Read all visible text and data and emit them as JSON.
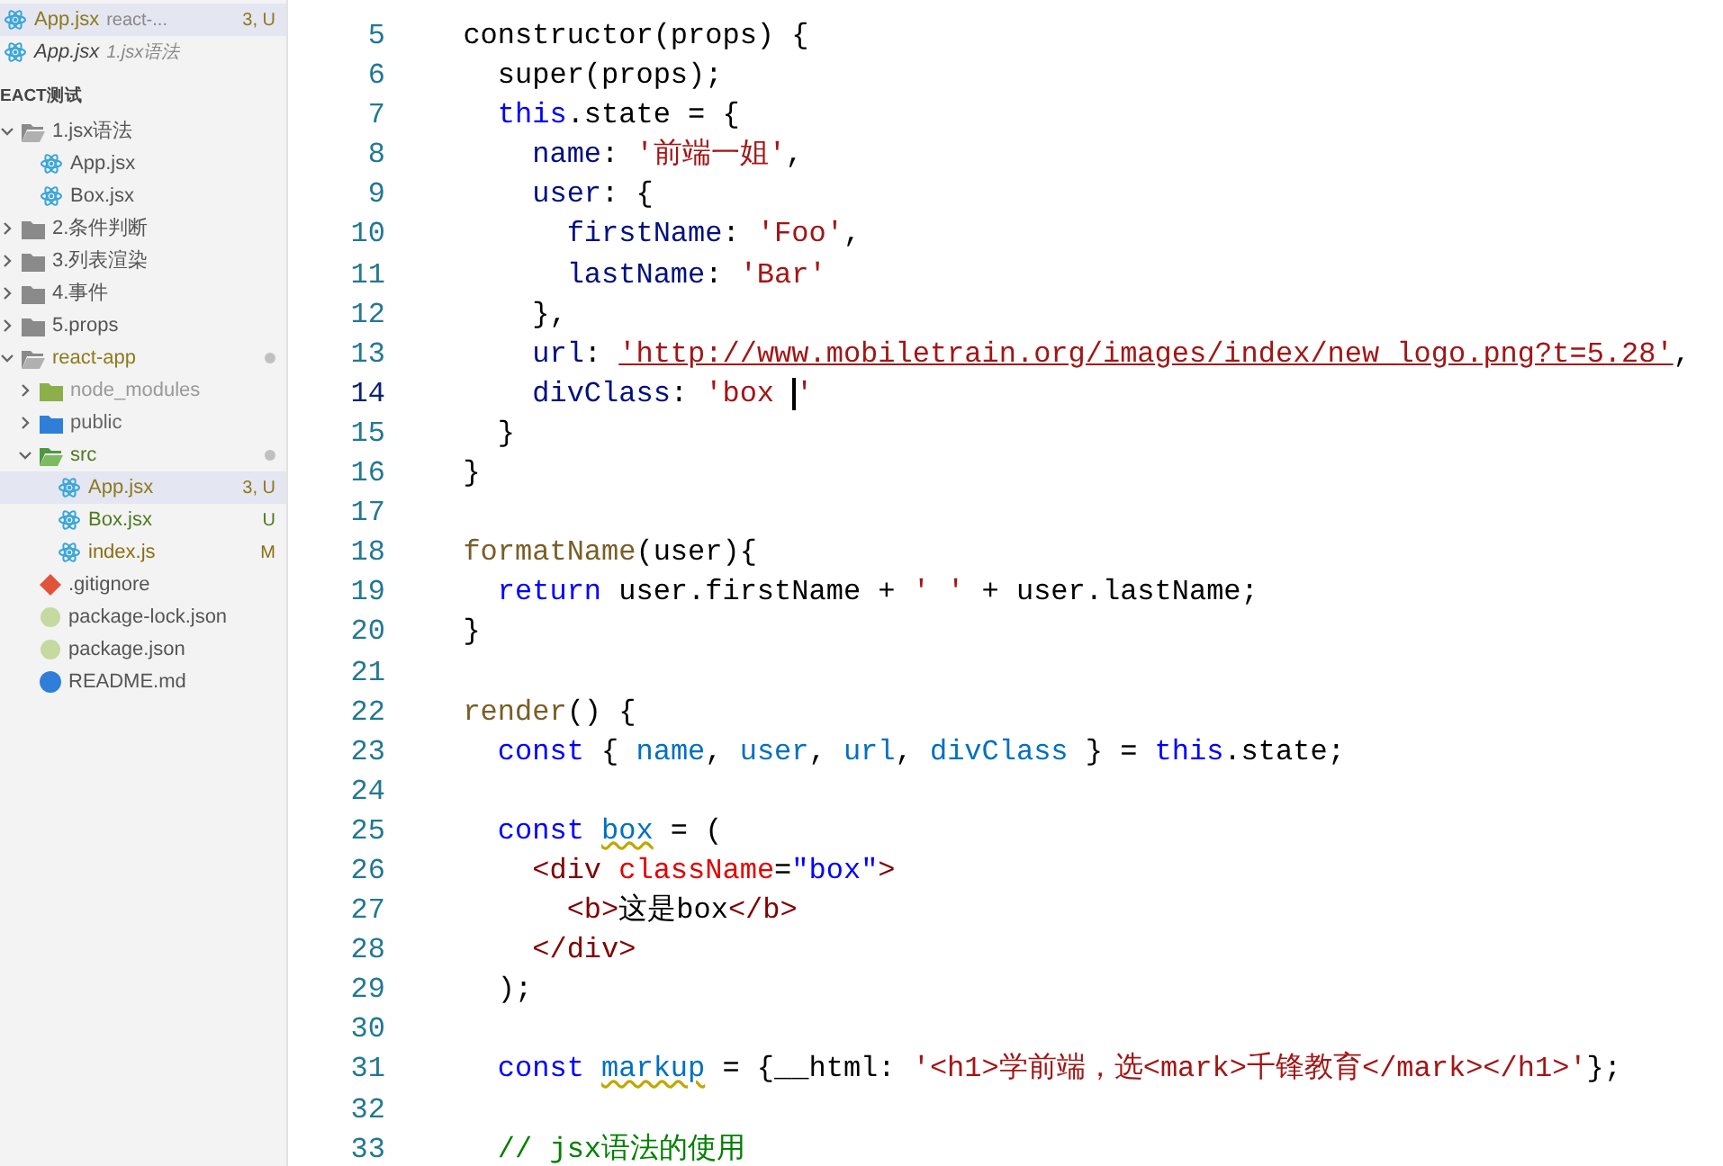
{
  "sidebar": {
    "open_editors": [
      {
        "label": "App.jsx",
        "description": "react-...",
        "badge": "3, U",
        "kind": "react",
        "color": "#8c7a1c",
        "preview": false,
        "selected": true
      },
      {
        "label": "App.jsx",
        "description": "1.jsx语法",
        "kind": "react",
        "color": "#444444",
        "preview": true,
        "selected": false
      }
    ],
    "section_title": "EACT测试",
    "tree": [
      {
        "label": "1.jsx语法",
        "kind": "folder-open",
        "color": "#555555",
        "expanded": true,
        "selected": false,
        "children": [
          {
            "label": "App.jsx",
            "kind": "react",
            "color": "#555555",
            "selected": false
          },
          {
            "label": "Box.jsx",
            "kind": "react",
            "color": "#555555",
            "selected": false
          }
        ]
      },
      {
        "label": "2.条件判断",
        "kind": "folder",
        "color": "#555555",
        "expanded": false,
        "selected": false
      },
      {
        "label": "3.列表渲染",
        "kind": "folder",
        "color": "#555555",
        "expanded": false,
        "selected": false
      },
      {
        "label": "4.事件",
        "kind": "folder",
        "color": "#555555",
        "expanded": false,
        "selected": false
      },
      {
        "label": "5.props",
        "kind": "folder",
        "color": "#555555",
        "expanded": false,
        "selected": false
      },
      {
        "label": "react-app",
        "kind": "folder-open",
        "color": "#8c7a1c",
        "dot": true,
        "expanded": true,
        "selected": false,
        "children": [
          {
            "label": "node_modules",
            "kind": "folder-node",
            "color": "#999999",
            "expanded": false,
            "selected": false
          },
          {
            "label": "public",
            "kind": "folder-public",
            "color": "#666666",
            "expanded": false,
            "selected": false
          },
          {
            "label": "src",
            "kind": "folder-src",
            "color": "#4e7a1e",
            "dot": true,
            "expanded": true,
            "selected": false,
            "children": [
              {
                "label": "App.jsx",
                "kind": "react",
                "color": "#8c7a1c",
                "badge": "3, U",
                "selected": true
              },
              {
                "label": "Box.jsx",
                "kind": "react",
                "color": "#4e7a1e",
                "badge": "U",
                "selected": false
              },
              {
                "label": "index.js",
                "kind": "react",
                "color": "#8c6e12",
                "badge": "M",
                "selected": false
              }
            ]
          },
          {
            "label": ".gitignore",
            "kind": "git",
            "color": "#555555",
            "selected": false
          },
          {
            "label": "package-lock.json",
            "kind": "json",
            "color": "#555555",
            "selected": false
          },
          {
            "label": "package.json",
            "kind": "json",
            "color": "#555555",
            "selected": false
          },
          {
            "label": "README.md",
            "kind": "info",
            "color": "#555555",
            "selected": false
          }
        ]
      }
    ]
  },
  "editor": {
    "lines": [
      {
        "number": "5",
        "tokens": [
          {
            "kind": "plain",
            "text": "  constructor(props) {"
          }
        ]
      },
      {
        "number": "6",
        "tokens": [
          {
            "kind": "plain",
            "text": "    super(props);"
          }
        ]
      },
      {
        "number": "7",
        "tokens": [
          {
            "kind": "keyword",
            "text": "    this"
          },
          {
            "kind": "plain",
            "text": ".state = {"
          }
        ]
      },
      {
        "number": "8",
        "tokens": [
          {
            "kind": "prop",
            "text": "      name"
          },
          {
            "kind": "plain",
            "text": ": "
          },
          {
            "kind": "string",
            "text": "'前端一姐'"
          },
          {
            "kind": "plain",
            "text": ","
          }
        ]
      },
      {
        "number": "9",
        "tokens": [
          {
            "kind": "prop",
            "text": "      user"
          },
          {
            "kind": "plain",
            "text": ": {"
          }
        ]
      },
      {
        "number": "10",
        "tokens": [
          {
            "kind": "prop",
            "text": "        firstName"
          },
          {
            "kind": "plain",
            "text": ": "
          },
          {
            "kind": "string",
            "text": "'Foo'"
          },
          {
            "kind": "plain",
            "text": ","
          }
        ]
      },
      {
        "number": "11",
        "tokens": [
          {
            "kind": "prop",
            "text": "        lastName"
          },
          {
            "kind": "plain",
            "text": ": "
          },
          {
            "kind": "string",
            "text": "'Bar'"
          }
        ]
      },
      {
        "number": "12",
        "tokens": [
          {
            "kind": "plain",
            "text": "      },"
          }
        ]
      },
      {
        "number": "13",
        "tokens": [
          {
            "kind": "prop",
            "text": "      url"
          },
          {
            "kind": "plain",
            "text": ": "
          },
          {
            "kind": "link",
            "text": "'http://www.mobiletrain.org/images/index/new_logo.png?t=5.28'"
          },
          {
            "kind": "plain",
            "text": ","
          }
        ]
      },
      {
        "number": "14",
        "current": true,
        "tokens": [
          {
            "kind": "prop",
            "text": "      divClass"
          },
          {
            "kind": "plain",
            "text": ": "
          },
          {
            "kind": "string",
            "text": "'box",
            "cursor_after": true
          },
          {
            "kind": "string",
            "text": "'"
          }
        ]
      },
      {
        "number": "15",
        "tokens": [
          {
            "kind": "plain",
            "text": "    }"
          }
        ]
      },
      {
        "number": "16",
        "tokens": [
          {
            "kind": "plain",
            "text": "  }"
          }
        ]
      },
      {
        "number": "17"
      },
      {
        "number": "18",
        "tokens": [
          {
            "kind": "function",
            "text": "  formatName"
          },
          {
            "kind": "plain",
            "text": "(user){"
          }
        ]
      },
      {
        "number": "19",
        "tokens": [
          {
            "kind": "keyword",
            "text": "    return"
          },
          {
            "kind": "plain",
            "text": " user.firstName + "
          },
          {
            "kind": "string",
            "text": "' '"
          },
          {
            "kind": "plain",
            "text": " + user.lastName;"
          }
        ]
      },
      {
        "number": "20",
        "tokens": [
          {
            "kind": "plain",
            "text": "  }"
          }
        ]
      },
      {
        "number": "21"
      },
      {
        "number": "22",
        "tokens": [
          {
            "kind": "function",
            "text": "  render"
          },
          {
            "kind": "plain",
            "text": "() {"
          }
        ]
      },
      {
        "number": "23",
        "tokens": [
          {
            "kind": "keyword",
            "text": "    const"
          },
          {
            "kind": "plain",
            "text": " { "
          },
          {
            "kind": "variable",
            "text": "name"
          },
          {
            "kind": "plain",
            "text": ", "
          },
          {
            "kind": "variable",
            "text": "user"
          },
          {
            "kind": "plain",
            "text": ", "
          },
          {
            "kind": "variable",
            "text": "url"
          },
          {
            "kind": "plain",
            "text": ", "
          },
          {
            "kind": "variable",
            "text": "divClass"
          },
          {
            "kind": "plain",
            "text": " } = "
          },
          {
            "kind": "keyword",
            "text": "this"
          },
          {
            "kind": "plain",
            "text": ".state;"
          }
        ]
      },
      {
        "number": "24"
      },
      {
        "number": "25",
        "tokens": [
          {
            "kind": "keyword",
            "text": "    const "
          },
          {
            "kind": "unused",
            "text": "box"
          },
          {
            "kind": "plain",
            "text": " = ("
          }
        ]
      },
      {
        "number": "26",
        "tokens": [
          {
            "kind": "tag",
            "text": "      <div "
          },
          {
            "kind": "attr",
            "text": "className"
          },
          {
            "kind": "plain",
            "text": "="
          },
          {
            "kind": "attrvalue",
            "text": "\"box\""
          },
          {
            "kind": "tag",
            "text": ">"
          }
        ]
      },
      {
        "number": "27",
        "tokens": [
          {
            "kind": "tag",
            "text": "        <b>"
          },
          {
            "kind": "plain",
            "text": "这是box"
          },
          {
            "kind": "tag",
            "text": "</b>"
          }
        ]
      },
      {
        "number": "28",
        "tokens": [
          {
            "kind": "tag",
            "text": "      </div>"
          }
        ]
      },
      {
        "number": "29",
        "tokens": [
          {
            "kind": "plain",
            "text": "    );"
          }
        ]
      },
      {
        "number": "30"
      },
      {
        "number": "31",
        "tokens": [
          {
            "kind": "keyword",
            "text": "    const "
          },
          {
            "kind": "unused",
            "text": "markup"
          },
          {
            "kind": "plain",
            "text": " = {__html: "
          },
          {
            "kind": "string",
            "text": "'<h1>学前端，选<mark>千锋教育</mark></h1>'"
          },
          {
            "kind": "plain",
            "text": "};"
          }
        ]
      },
      {
        "number": "32"
      },
      {
        "number": "33",
        "tokens": [
          {
            "kind": "comment",
            "text": "    // jsx语法的使用"
          }
        ]
      }
    ]
  }
}
